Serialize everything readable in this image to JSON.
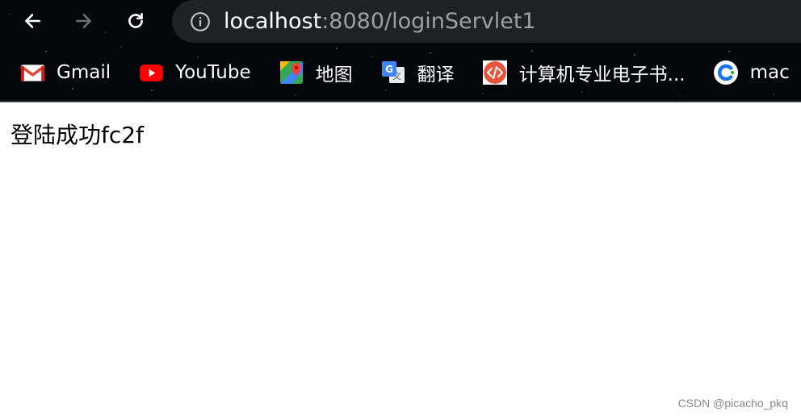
{
  "browser": {
    "address_bar": {
      "host": "localhost",
      "path": ":8080/loginServlet1"
    },
    "bookmarks": [
      {
        "label": "Gmail",
        "icon": "gmail-icon"
      },
      {
        "label": "YouTube",
        "icon": "youtube-icon"
      },
      {
        "label": "地图",
        "icon": "maps-icon"
      },
      {
        "label": "翻译",
        "icon": "translate-icon"
      },
      {
        "label": "计算机专业电子书...",
        "icon": "code-icon"
      },
      {
        "label": "mac",
        "icon": "c-logo-icon"
      }
    ]
  },
  "page": {
    "message": "登陆成功fc2f"
  },
  "watermark": "CSDN @picacho_pkq",
  "colors": {
    "chrome_background": "#05060a",
    "omnibox": "#202124",
    "url_host": "#ffffff",
    "url_path": "#9aa0a6",
    "youtube_red": "#ff0000",
    "code_icon_bg": "#e8553e"
  }
}
